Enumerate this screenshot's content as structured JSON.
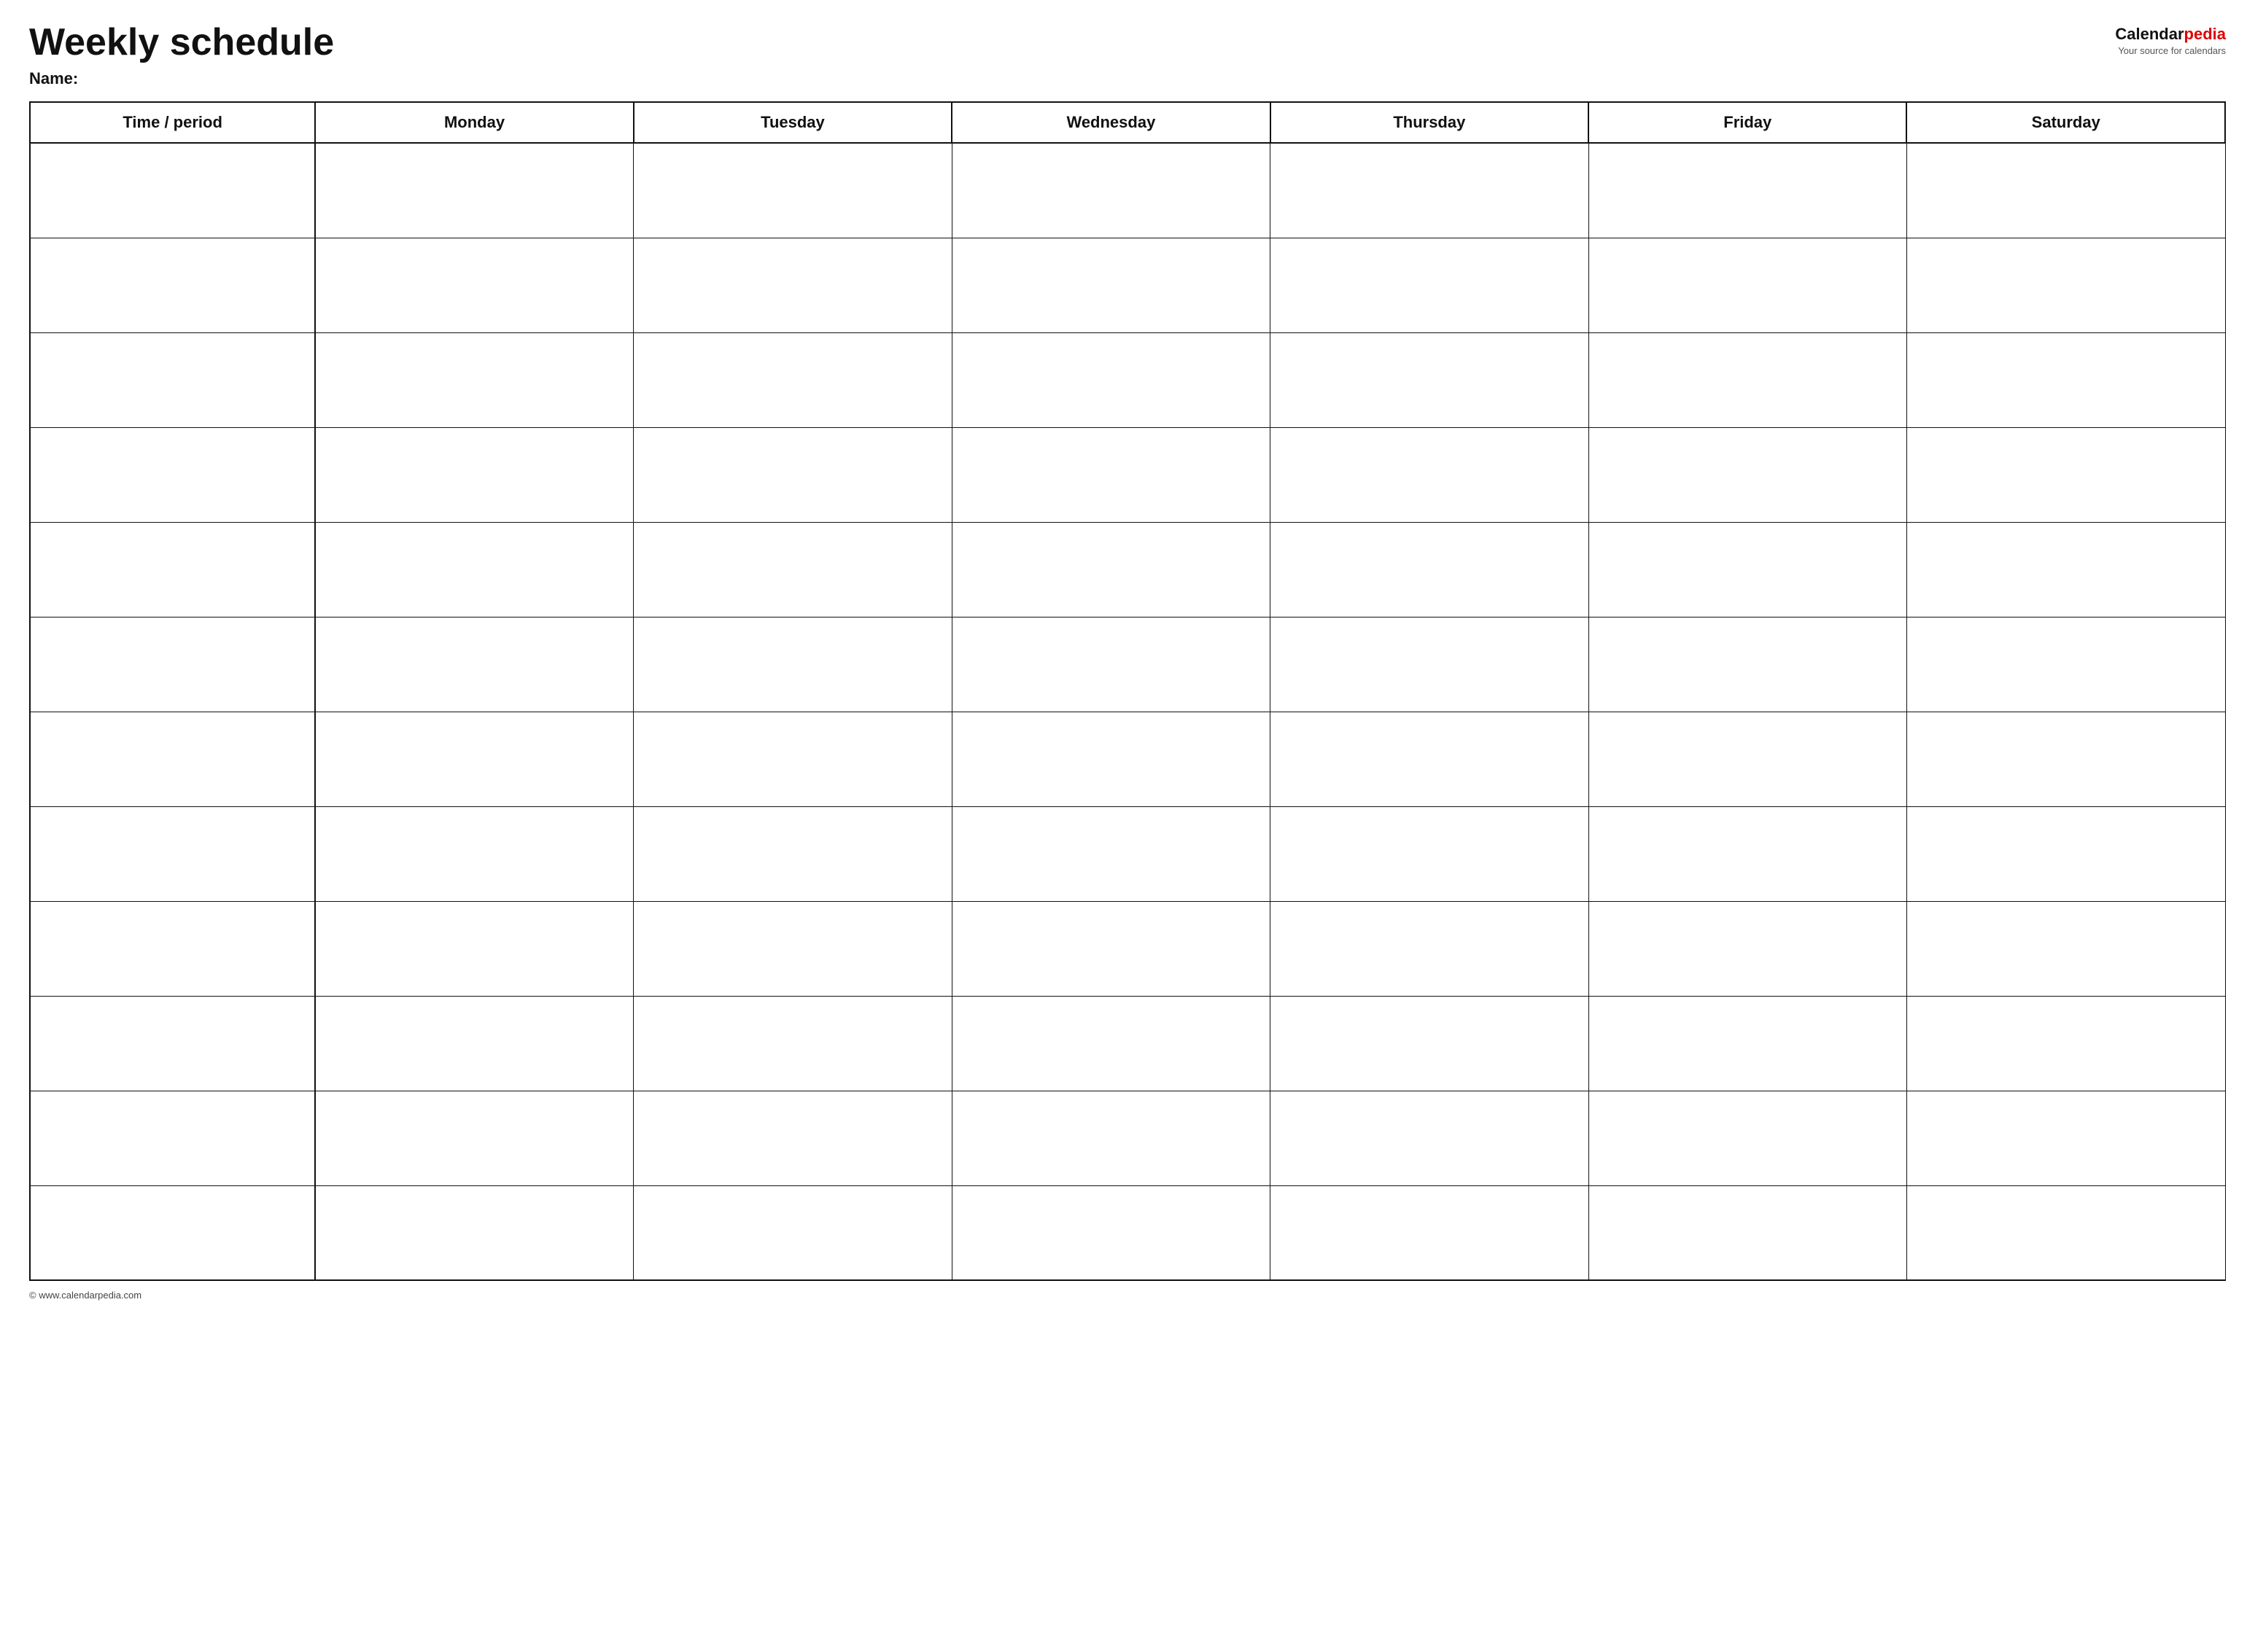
{
  "header": {
    "title": "Weekly schedule",
    "name_label": "Name:",
    "logo": {
      "calendar_text": "Calendar",
      "pedia_text": "pedia",
      "subtitle": "Your source for calendars"
    }
  },
  "table": {
    "columns": [
      "Time / period",
      "Monday",
      "Tuesday",
      "Wednesday",
      "Thursday",
      "Friday",
      "Saturday"
    ],
    "row_count": 12
  },
  "footer": {
    "copyright": "© www.calendarpedia.com"
  }
}
